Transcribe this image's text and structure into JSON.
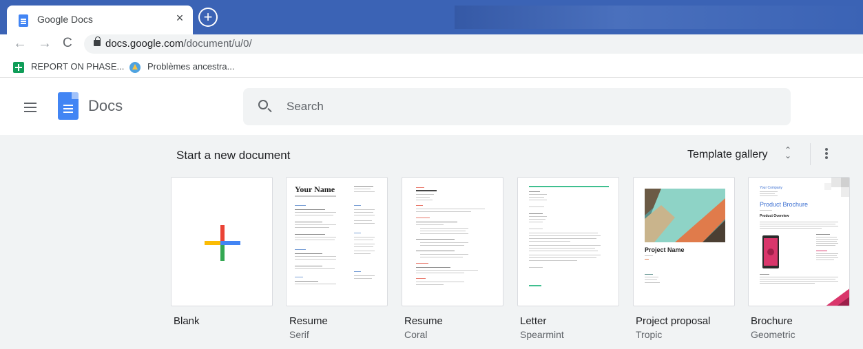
{
  "browser": {
    "tab_title": "Google Docs",
    "tab_close": "×",
    "new_tab": "+",
    "url_host": "docs.google.com",
    "url_path": "/document/u/0/",
    "bookmarks": [
      {
        "label": "REPORT ON PHASE..."
      },
      {
        "label": "Problèmes ancestra..."
      }
    ]
  },
  "app": {
    "name": "Docs",
    "search_placeholder": "Search"
  },
  "templates": {
    "heading": "Start a new document",
    "gallery_label": "Template gallery",
    "items": [
      {
        "name": "Blank",
        "sub": ""
      },
      {
        "name": "Resume",
        "sub": "Serif",
        "preview_title": "Your Name"
      },
      {
        "name": "Resume",
        "sub": "Coral"
      },
      {
        "name": "Letter",
        "sub": "Spearmint"
      },
      {
        "name": "Project proposal",
        "sub": "Tropic",
        "preview_title": "Project Name"
      },
      {
        "name": "Brochure",
        "sub": "Geometric",
        "preview_company": "Your Company",
        "preview_title": "Product Brochure",
        "preview_section": "Product Overview"
      }
    ]
  }
}
